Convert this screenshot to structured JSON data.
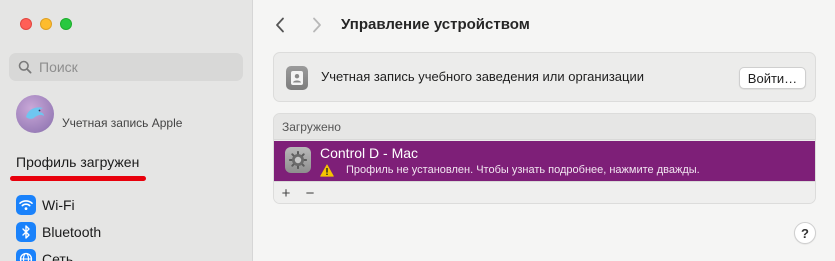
{
  "sidebar": {
    "search": {
      "placeholder": "Поиск"
    },
    "account": {
      "label": "Учетная запись Apple"
    },
    "annotation": {
      "text": "Профиль загружен",
      "color": "#e8000c"
    },
    "items": [
      {
        "label": "Wi-Fi",
        "icon": "wifi-icon"
      },
      {
        "label": "Bluetooth",
        "icon": "bluetooth-icon"
      },
      {
        "label": "Сеть",
        "icon": "network-icon"
      }
    ]
  },
  "header": {
    "title": "Управление устройством"
  },
  "org_card": {
    "text": "Учетная запись учебного заведения или организации",
    "button": "Войти…"
  },
  "profiles": {
    "header": "Загружено",
    "items": [
      {
        "title": "Control D - Mac",
        "subtitle": "Профиль не установлен. Чтобы узнать подробнее, нажмите дважды.",
        "selected": true,
        "highlight_color": "#7e1f78"
      }
    ],
    "add_label": "+",
    "remove_label": "−"
  },
  "help_label": "?"
}
